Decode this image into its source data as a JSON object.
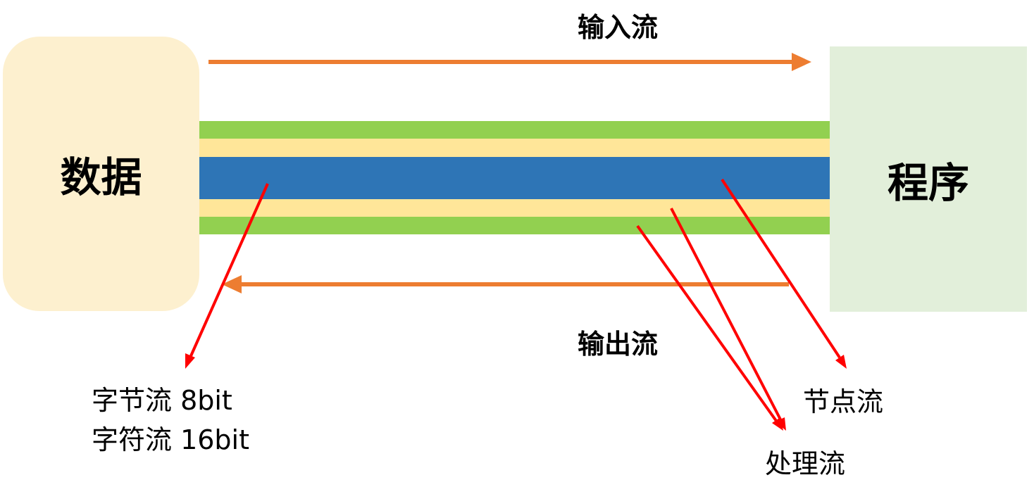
{
  "source_box": {
    "label": "数据"
  },
  "target_box": {
    "label": "程序"
  },
  "input_stream": {
    "label": "输入流"
  },
  "output_stream": {
    "label": "输出流"
  },
  "annotations": {
    "byte_stream": "字节流 8bit",
    "char_stream": "字符流 16bit",
    "node_stream": "节点流",
    "processing_stream": "处理流"
  },
  "colors": {
    "source_box": "#fdf0cf",
    "target_box": "#e2efda",
    "band_green": "#92d050",
    "band_yellow": "#ffe699",
    "band_blue": "#2e75b6",
    "flow_arrow": "#ed7d31",
    "pointer_arrow": "#ff0000"
  }
}
